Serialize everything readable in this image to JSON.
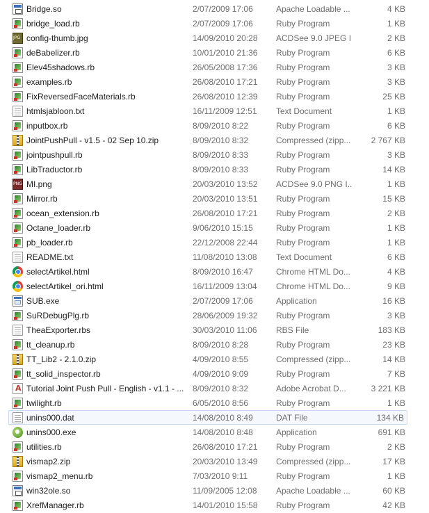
{
  "files": [
    {
      "name": "Bridge.so",
      "date": "2/07/2009 17:06",
      "type": "Apache Loadable ...",
      "size": "4 KB",
      "icon": "so-file-icon",
      "kind": "so"
    },
    {
      "name": "bridge_load.rb",
      "date": "2/07/2009 17:06",
      "type": "Ruby Program",
      "size": "1 KB",
      "icon": "ruby-file-icon",
      "kind": "rb"
    },
    {
      "name": "config-thumb.jpg",
      "date": "14/09/2010 20:28",
      "type": "ACDSee 9.0 JPEG I...",
      "size": "2 KB",
      "icon": "jpg-file-icon",
      "kind": "jpg"
    },
    {
      "name": "deBabelizer.rb",
      "date": "10/01/2010 21:36",
      "type": "Ruby Program",
      "size": "6 KB",
      "icon": "ruby-file-icon",
      "kind": "rb"
    },
    {
      "name": "Elev45shadows.rb",
      "date": "26/05/2008 17:36",
      "type": "Ruby Program",
      "size": "3 KB",
      "icon": "ruby-file-icon",
      "kind": "rb"
    },
    {
      "name": "examples.rb",
      "date": "26/08/2010 17:21",
      "type": "Ruby Program",
      "size": "3 KB",
      "icon": "ruby-file-icon",
      "kind": "rb"
    },
    {
      "name": "FixReversedFaceMaterials.rb",
      "date": "26/08/2010 12:39",
      "type": "Ruby Program",
      "size": "25 KB",
      "icon": "ruby-file-icon",
      "kind": "rb"
    },
    {
      "name": "htmlsjabloon.txt",
      "date": "16/11/2009 12:51",
      "type": "Text Document",
      "size": "1 KB",
      "icon": "text-file-icon",
      "kind": "txt"
    },
    {
      "name": "inputbox.rb",
      "date": "8/09/2010 8:22",
      "type": "Ruby Program",
      "size": "6 KB",
      "icon": "ruby-file-icon",
      "kind": "rb"
    },
    {
      "name": "JointPushPull - v1.5 - 02 Sep 10.zip",
      "date": "8/09/2010 8:32",
      "type": "Compressed (zipp...",
      "size": "2 767 KB",
      "icon": "zip-file-icon",
      "kind": "zip"
    },
    {
      "name": "jointpushpull.rb",
      "date": "8/09/2010 8:33",
      "type": "Ruby Program",
      "size": "3 KB",
      "icon": "ruby-file-icon",
      "kind": "rb"
    },
    {
      "name": "LibTraductor.rb",
      "date": "8/09/2010 8:33",
      "type": "Ruby Program",
      "size": "14 KB",
      "icon": "ruby-file-icon",
      "kind": "rb"
    },
    {
      "name": "MI.png",
      "date": "20/03/2010 13:52",
      "type": "ACDSee 9.0 PNG I...",
      "size": "1 KB",
      "icon": "png-file-icon",
      "kind": "png"
    },
    {
      "name": "Mirror.rb",
      "date": "20/03/2010 13:51",
      "type": "Ruby Program",
      "size": "15 KB",
      "icon": "ruby-file-icon",
      "kind": "rb"
    },
    {
      "name": "ocean_extension.rb",
      "date": "26/08/2010 17:21",
      "type": "Ruby Program",
      "size": "2 KB",
      "icon": "ruby-file-icon",
      "kind": "rb"
    },
    {
      "name": "Octane_loader.rb",
      "date": "9/06/2010 15:15",
      "type": "Ruby Program",
      "size": "1 KB",
      "icon": "ruby-file-icon",
      "kind": "rb"
    },
    {
      "name": "pb_loader.rb",
      "date": "22/12/2008 22:44",
      "type": "Ruby Program",
      "size": "1 KB",
      "icon": "ruby-file-icon",
      "kind": "rb"
    },
    {
      "name": "README.txt",
      "date": "11/08/2010 13:08",
      "type": "Text Document",
      "size": "6 KB",
      "icon": "text-file-icon",
      "kind": "txt"
    },
    {
      "name": "selectArtikel.html",
      "date": "8/09/2010 16:47",
      "type": "Chrome HTML Do...",
      "size": "4 KB",
      "icon": "chrome-html-file-icon",
      "kind": "html"
    },
    {
      "name": "selectArtikel_ori.html",
      "date": "16/11/2009 13:04",
      "type": "Chrome HTML Do...",
      "size": "9 KB",
      "icon": "chrome-html-file-icon",
      "kind": "html"
    },
    {
      "name": "SUB.exe",
      "date": "2/07/2009 17:06",
      "type": "Application",
      "size": "16 KB",
      "icon": "exe-file-icon",
      "kind": "exe"
    },
    {
      "name": "SuRDebugPlg.rb",
      "date": "28/06/2009 19:32",
      "type": "Ruby Program",
      "size": "3 KB",
      "icon": "ruby-file-icon",
      "kind": "rb"
    },
    {
      "name": "TheaExporter.rbs",
      "date": "30/03/2010 11:06",
      "type": "RBS File",
      "size": "183 KB",
      "icon": "rbs-file-icon",
      "kind": "txt"
    },
    {
      "name": "tt_cleanup.rb",
      "date": "8/09/2010 8:28",
      "type": "Ruby Program",
      "size": "23 KB",
      "icon": "ruby-file-icon",
      "kind": "rb"
    },
    {
      "name": "TT_Lib2 - 2.1.0.zip",
      "date": "4/09/2010 8:55",
      "type": "Compressed (zipp...",
      "size": "14 KB",
      "icon": "zip-file-icon",
      "kind": "zip"
    },
    {
      "name": "tt_solid_inspector.rb",
      "date": "4/09/2010 9:09",
      "type": "Ruby Program",
      "size": "7 KB",
      "icon": "ruby-file-icon",
      "kind": "rb"
    },
    {
      "name": "Tutorial Joint Push Pull - English - v1.1 - ...",
      "date": "8/09/2010 8:32",
      "type": "Adobe Acrobat D...",
      "size": "3 221 KB",
      "icon": "pdf-file-icon",
      "kind": "pdf"
    },
    {
      "name": "twilight.rb",
      "date": "6/05/2010 8:56",
      "type": "Ruby Program",
      "size": "1 KB",
      "icon": "ruby-file-icon",
      "kind": "rb"
    },
    {
      "name": "unins000.dat",
      "date": "14/08/2010 8:49",
      "type": "DAT File",
      "size": "134 KB",
      "icon": "dat-file-icon",
      "kind": "txt",
      "selected": true
    },
    {
      "name": "unins000.exe",
      "date": "14/08/2010 8:48",
      "type": "Application",
      "size": "691 KB",
      "icon": "setup-exe-icon",
      "kind": "setup"
    },
    {
      "name": "utilities.rb",
      "date": "26/08/2010 17:21",
      "type": "Ruby Program",
      "size": "2 KB",
      "icon": "ruby-file-icon",
      "kind": "rb"
    },
    {
      "name": "vismap2.zip",
      "date": "20/03/2010 13:49",
      "type": "Compressed (zipp...",
      "size": "17 KB",
      "icon": "zip-file-icon",
      "kind": "zip"
    },
    {
      "name": "vismap2_menu.rb",
      "date": "7/03/2010 9:11",
      "type": "Ruby Program",
      "size": "1 KB",
      "icon": "ruby-file-icon",
      "kind": "rb"
    },
    {
      "name": "win32ole.so",
      "date": "11/09/2005 12:08",
      "type": "Apache Loadable ...",
      "size": "60 KB",
      "icon": "so-file-icon",
      "kind": "so"
    },
    {
      "name": "XrefManager.rb",
      "date": "14/01/2010 15:58",
      "type": "Ruby Program",
      "size": "42 KB",
      "icon": "ruby-file-icon",
      "kind": "rb"
    }
  ]
}
